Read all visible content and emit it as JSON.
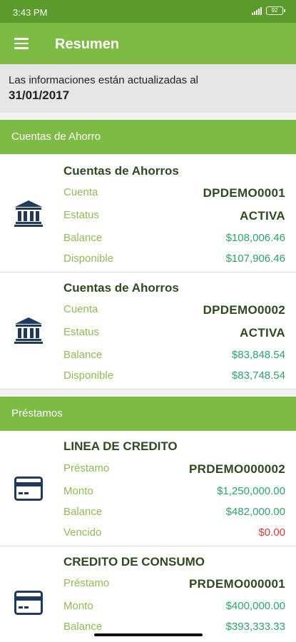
{
  "status_bar": {
    "time": "3:43 PM",
    "battery": "92"
  },
  "app_bar": {
    "title": "Resumen"
  },
  "info": {
    "line1": "Las informaciones están actualizadas al",
    "date": "31/01/2017"
  },
  "colors": {
    "primary": "#7dbb45",
    "status": "#5a9b2c",
    "amount": "#2ea36a",
    "overdue": "#d23c3c",
    "label": "#8fba55"
  },
  "savings": {
    "header": "Cuentas de Ahorro",
    "accounts": [
      {
        "title": "Cuentas de Ahorros",
        "icon": "bank-icon",
        "account_label": "Cuenta",
        "account": "DPDEMO0001",
        "status_label": "Estatus",
        "status": "ACTIVA",
        "balance_label": "Balance",
        "balance": "$108,006.46",
        "available_label": "Disponible",
        "available": "$107,906.46"
      },
      {
        "title": "Cuentas de Ahorros",
        "icon": "bank-icon",
        "account_label": "Cuenta",
        "account": "DPDEMO0002",
        "status_label": "Estatus",
        "status": "ACTIVA",
        "balance_label": "Balance",
        "balance": "$83,848.54",
        "available_label": "Disponible",
        "available": "$83,748.54"
      }
    ]
  },
  "loans": {
    "header": "Préstamos",
    "items": [
      {
        "title": "LINEA DE CREDITO",
        "icon": "credit-card-icon",
        "loan_label": "Préstamo",
        "loan": "PRDEMO000002",
        "amount_label": "Monto",
        "amount": "$1,250,000.00",
        "balance_label": "Balance",
        "balance": "$482,000.00",
        "overdue_label": "Vencido",
        "overdue": "$0.00"
      },
      {
        "title": "CREDITO DE CONSUMO",
        "icon": "credit-card-icon",
        "loan_label": "Préstamo",
        "loan": "PRDEMO000001",
        "amount_label": "Monto",
        "amount": "$400,000.00",
        "balance_label": "Balance",
        "balance": "$393,333.33"
      }
    ]
  }
}
